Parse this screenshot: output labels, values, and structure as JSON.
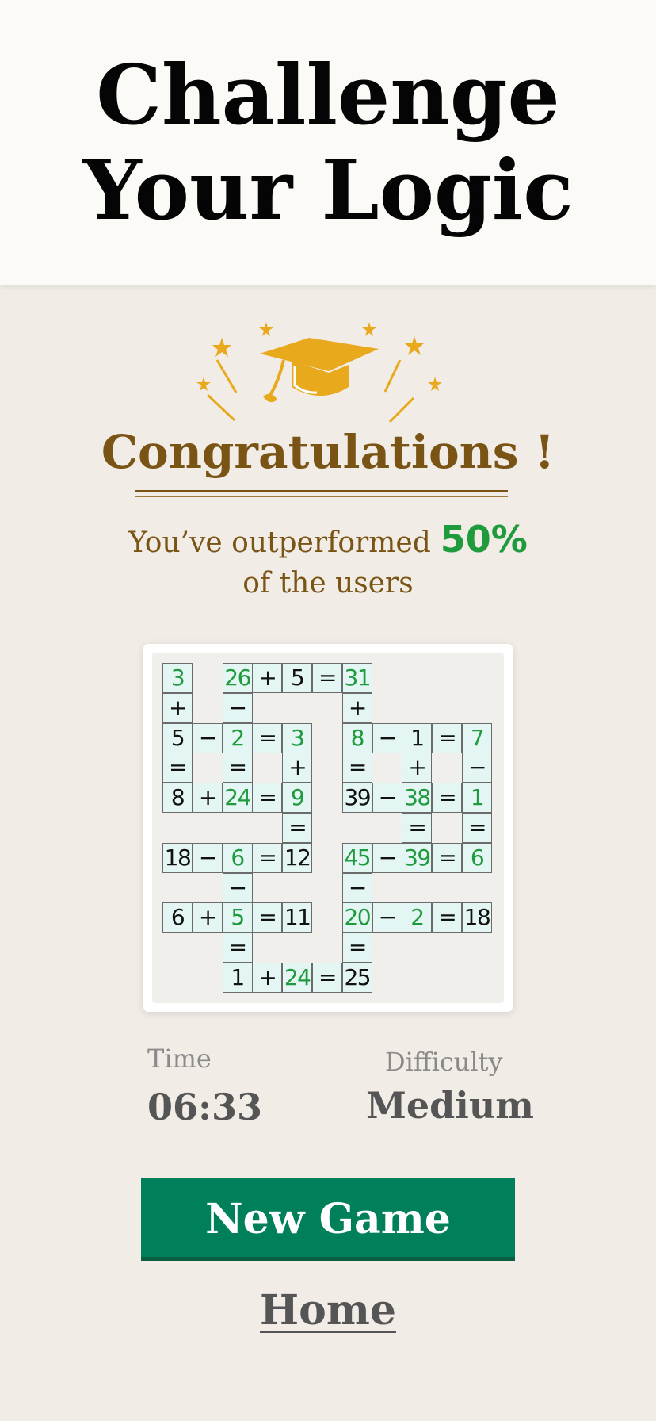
{
  "header": {
    "title_line1": "Challenge",
    "title_line2": "Your  Logic"
  },
  "result": {
    "congrats_text": "Congratulations !",
    "outperform_prefix": "You’ve outperformed",
    "percentile": "50%",
    "outperform_suffix": "of the users",
    "icon": "graduation-cap-celebration-icon"
  },
  "board": {
    "rows": 11,
    "cols": 11,
    "cells": [
      {
        "r": 0,
        "c": 0,
        "v": "3",
        "kind": "solved"
      },
      {
        "r": 0,
        "c": 2,
        "v": "26",
        "kind": "solved"
      },
      {
        "r": 0,
        "c": 3,
        "v": "+",
        "kind": "op"
      },
      {
        "r": 0,
        "c": 4,
        "v": "5",
        "kind": "given"
      },
      {
        "r": 0,
        "c": 5,
        "v": "=",
        "kind": "op"
      },
      {
        "r": 0,
        "c": 6,
        "v": "31",
        "kind": "solved"
      },
      {
        "r": 1,
        "c": 0,
        "v": "+",
        "kind": "op"
      },
      {
        "r": 1,
        "c": 2,
        "v": "−",
        "kind": "op"
      },
      {
        "r": 1,
        "c": 6,
        "v": "+",
        "kind": "op"
      },
      {
        "r": 2,
        "c": 0,
        "v": "5",
        "kind": "given"
      },
      {
        "r": 2,
        "c": 1,
        "v": "−",
        "kind": "op"
      },
      {
        "r": 2,
        "c": 2,
        "v": "2",
        "kind": "solved"
      },
      {
        "r": 2,
        "c": 3,
        "v": "=",
        "kind": "op"
      },
      {
        "r": 2,
        "c": 4,
        "v": "3",
        "kind": "solved"
      },
      {
        "r": 2,
        "c": 6,
        "v": "8",
        "kind": "solved"
      },
      {
        "r": 2,
        "c": 7,
        "v": "−",
        "kind": "op"
      },
      {
        "r": 2,
        "c": 8,
        "v": "1",
        "kind": "given"
      },
      {
        "r": 2,
        "c": 9,
        "v": "=",
        "kind": "op"
      },
      {
        "r": 2,
        "c": 10,
        "v": "7",
        "kind": "solved"
      },
      {
        "r": 3,
        "c": 0,
        "v": "=",
        "kind": "op"
      },
      {
        "r": 3,
        "c": 2,
        "v": "=",
        "kind": "op"
      },
      {
        "r": 3,
        "c": 4,
        "v": "+",
        "kind": "op"
      },
      {
        "r": 3,
        "c": 6,
        "v": "=",
        "kind": "op"
      },
      {
        "r": 3,
        "c": 8,
        "v": "+",
        "kind": "op"
      },
      {
        "r": 3,
        "c": 10,
        "v": "−",
        "kind": "op"
      },
      {
        "r": 4,
        "c": 0,
        "v": "8",
        "kind": "given"
      },
      {
        "r": 4,
        "c": 1,
        "v": "+",
        "kind": "op"
      },
      {
        "r": 4,
        "c": 2,
        "v": "24",
        "kind": "solved"
      },
      {
        "r": 4,
        "c": 3,
        "v": "=",
        "kind": "op"
      },
      {
        "r": 4,
        "c": 4,
        "v": "9",
        "kind": "solved"
      },
      {
        "r": 4,
        "c": 6,
        "v": "39",
        "kind": "given"
      },
      {
        "r": 4,
        "c": 7,
        "v": "−",
        "kind": "op"
      },
      {
        "r": 4,
        "c": 8,
        "v": "38",
        "kind": "solved"
      },
      {
        "r": 4,
        "c": 9,
        "v": "=",
        "kind": "op"
      },
      {
        "r": 4,
        "c": 10,
        "v": "1",
        "kind": "solved"
      },
      {
        "r": 5,
        "c": 4,
        "v": "=",
        "kind": "op"
      },
      {
        "r": 5,
        "c": 8,
        "v": "=",
        "kind": "op"
      },
      {
        "r": 5,
        "c": 10,
        "v": "=",
        "kind": "op"
      },
      {
        "r": 6,
        "c": 0,
        "v": "18",
        "kind": "given"
      },
      {
        "r": 6,
        "c": 1,
        "v": "−",
        "kind": "op"
      },
      {
        "r": 6,
        "c": 2,
        "v": "6",
        "kind": "solved"
      },
      {
        "r": 6,
        "c": 3,
        "v": "=",
        "kind": "op"
      },
      {
        "r": 6,
        "c": 4,
        "v": "12",
        "kind": "given"
      },
      {
        "r": 6,
        "c": 6,
        "v": "45",
        "kind": "solved"
      },
      {
        "r": 6,
        "c": 7,
        "v": "−",
        "kind": "op"
      },
      {
        "r": 6,
        "c": 8,
        "v": "39",
        "kind": "solved"
      },
      {
        "r": 6,
        "c": 9,
        "v": "=",
        "kind": "op"
      },
      {
        "r": 6,
        "c": 10,
        "v": "6",
        "kind": "solved"
      },
      {
        "r": 7,
        "c": 2,
        "v": "−",
        "kind": "op"
      },
      {
        "r": 7,
        "c": 6,
        "v": "−",
        "kind": "op"
      },
      {
        "r": 8,
        "c": 0,
        "v": "6",
        "kind": "given"
      },
      {
        "r": 8,
        "c": 1,
        "v": "+",
        "kind": "op"
      },
      {
        "r": 8,
        "c": 2,
        "v": "5",
        "kind": "solved"
      },
      {
        "r": 8,
        "c": 3,
        "v": "=",
        "kind": "op"
      },
      {
        "r": 8,
        "c": 4,
        "v": "11",
        "kind": "given"
      },
      {
        "r": 8,
        "c": 6,
        "v": "20",
        "kind": "solved"
      },
      {
        "r": 8,
        "c": 7,
        "v": "−",
        "kind": "op"
      },
      {
        "r": 8,
        "c": 8,
        "v": "2",
        "kind": "solved"
      },
      {
        "r": 8,
        "c": 9,
        "v": "=",
        "kind": "op"
      },
      {
        "r": 8,
        "c": 10,
        "v": "18",
        "kind": "given"
      },
      {
        "r": 9,
        "c": 2,
        "v": "=",
        "kind": "op"
      },
      {
        "r": 9,
        "c": 6,
        "v": "=",
        "kind": "op"
      },
      {
        "r": 10,
        "c": 2,
        "v": "1",
        "kind": "given"
      },
      {
        "r": 10,
        "c": 3,
        "v": "+",
        "kind": "op"
      },
      {
        "r": 10,
        "c": 4,
        "v": "24",
        "kind": "solved"
      },
      {
        "r": 10,
        "c": 5,
        "v": "=",
        "kind": "op"
      },
      {
        "r": 10,
        "c": 6,
        "v": "25",
        "kind": "given"
      }
    ]
  },
  "stats": {
    "time_label": "Time",
    "time_value": "06:33",
    "difficulty_label": "Difficulty",
    "difficulty_value": "Medium"
  },
  "actions": {
    "new_game_label": "New Game",
    "home_label": "Home"
  },
  "colors": {
    "accent_green": "#00805a",
    "solved_green": "#1f9a3c",
    "brown": "#7a5414",
    "gold": "#e8a91c",
    "cell_bg": "#e3f6f4"
  }
}
